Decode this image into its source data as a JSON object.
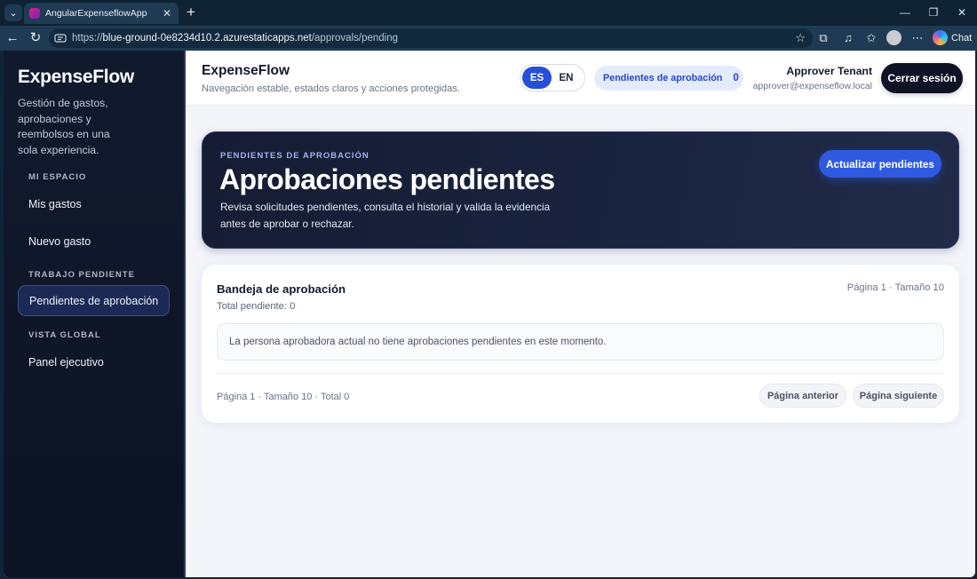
{
  "browser": {
    "tab_title": "AngularExpenseflowApp",
    "url_scheme": "https://",
    "url_host": "blue-ground-0e8234d10.2.azurestaticapps.net",
    "url_path": "/approvals/pending",
    "chat_label": "Chat"
  },
  "sidebar": {
    "brand": "ExpenseFlow",
    "description": "Gestión de gastos, aprobaciones y reembolsos en una sola experiencia.",
    "sections": [
      {
        "label": "MI ESPACIO",
        "items": [
          "Mis gastos",
          "Nuevo gasto"
        ]
      },
      {
        "label": "TRABAJO PENDIENTE",
        "items": [
          "Pendientes de aprobación"
        ]
      },
      {
        "label": "VISTA GLOBAL",
        "items": [
          "Panel ejecutivo"
        ]
      }
    ],
    "active_item": "Pendientes de aprobación"
  },
  "header": {
    "title": "ExpenseFlow",
    "subtitle": "Navegación estable, estados claros y acciones protegidas.",
    "languages": [
      "ES",
      "EN"
    ],
    "active_language": "ES",
    "pending_label": "Pendientes de aprobación",
    "pending_count": "0",
    "user_name": "Approver Tenant",
    "user_email": "approver@expenseflow.local",
    "logout_label": "Cerrar sesión"
  },
  "hero": {
    "eyebrow": "PENDIENTES DE APROBACIÓN",
    "title": "Aprobaciones pendientes",
    "description": "Revisa solicitudes pendientes, consulta el historial y valida la evidencia antes de aprobar o rechazar.",
    "refresh_label": "Actualizar pendientes"
  },
  "inbox": {
    "title": "Bandeja de aprobación",
    "total": "Total pendiente: 0",
    "page_info": "Página 1 · Tamaño 10",
    "empty_message": "La persona aprobadora actual no tiene aprobaciones pendientes en este momento.",
    "footer_info": "Página 1 · Tamaño 10 · Total 0",
    "prev_label": "Página anterior",
    "next_label": "Página siguiente"
  },
  "colors": {
    "accent": "#2f5ae0",
    "sidebar_bg": "#111a2d",
    "hero_bg": "#1b2440"
  }
}
